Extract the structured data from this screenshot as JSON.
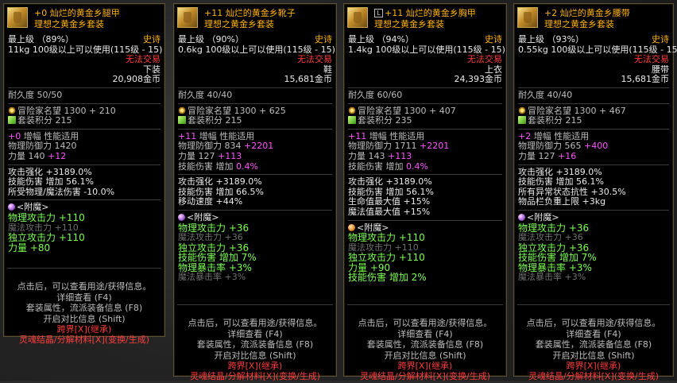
{
  "colors": {
    "legendary": "#ffb400",
    "untradeable": "#ff3c3c",
    "option_green": "#7dff52",
    "bonus_magenta": "#ff55ff",
    "crossover_red": "#ff3c3c"
  },
  "items": [
    {
      "icon": "leg-armor-icon",
      "title": "+0 灿烂的黄金乡腿甲",
      "set_name": "理想之黄金乡套装",
      "grade": "最上级 （89%）",
      "rarity": "史诗",
      "weight_use": "11kg   100级以上可以使用(115级 - 15)",
      "trade": "无法交易",
      "slot": "下装",
      "price": "20,908金币",
      "durability": "耐久度 50/50",
      "fame": "冒险家名望 1300 + 210",
      "set_points": "套装积分 215",
      "amp_line": "+0  增幅 性能适用",
      "amp_prefix": "+0",
      "amp_text": "增幅 性能适用",
      "def_line": "物理防御力 1420",
      "def_bonus": "",
      "str_line": "力量 140",
      "str_bonus": "+12",
      "stats": [
        {
          "text": "攻击强化 +3189.0%",
          "hl": ""
        },
        {
          "text": "技能伤害  增加 56.1%",
          "hl": ""
        },
        {
          "text": "所受物理/魔法伤害 -10.0%",
          "hl": ""
        }
      ],
      "enchant_label": "<附魔>",
      "enchant": [
        {
          "text": "物理攻击力 +110",
          "cls": "white"
        },
        {
          "text": "魔法攻击力 +110",
          "cls": "dim"
        },
        {
          "text": "独立攻击力 +110",
          "cls": "white"
        },
        {
          "text": "力量 +80",
          "cls": "white"
        }
      ],
      "footer": [
        "点击后，可以查看用途/获得信息。",
        "详细查看 (F4)",
        "套装属性，流派装备信息 (F8)",
        "开启对比信息 (Shift)",
        "跨界[X](继承)",
        "灵魂结晶/分解材料[X](变换/生成)"
      ]
    },
    {
      "icon": "boots-icon",
      "title": "+11 灿烂的黄金乡靴子",
      "set_name": "理想之黄金乡套装",
      "grade": "最上级 （90%）",
      "rarity": "史诗",
      "weight_use": "0.6kg   100级以上可以使用(115级 - 15)",
      "trade": "无法交易",
      "slot": "鞋",
      "price": "15,681金币",
      "durability": "耐久度 40/40",
      "fame": "冒险家名望 1300 + 625",
      "set_points": "套装积分 215",
      "amp_prefix": "+11",
      "amp_text": "增幅 性能适用",
      "def_line": "物理防御力 834",
      "def_bonus": "+2201",
      "str_line": "力量 127",
      "str_bonus": "+113",
      "skill_line": "技能伤害  增加",
      "skill_bonus": "0.4%",
      "stats": [
        {
          "text": "攻击强化 +3189.0%"
        },
        {
          "text": "技能伤害  增加 66.5%"
        },
        {
          "text": "移动速度 +44%"
        }
      ],
      "enchant_label": "<附魔>",
      "enchant": [
        {
          "text": "物理攻击力 +36",
          "cls": "white"
        },
        {
          "text": "魔法攻击力 +36",
          "cls": "dim"
        },
        {
          "text": "独立攻击力 +36",
          "cls": "white"
        },
        {
          "text": "技能伤害  增加 7%",
          "cls": "white"
        },
        {
          "text": "物理暴击率 +3%",
          "cls": "white"
        },
        {
          "text": "魔法暴击率 +3%",
          "cls": "dim"
        }
      ],
      "footer": [
        "点击后，可以查看用途/获得信息。",
        "详细查看 (F4)",
        "套装属性，流派装备信息 (F8)",
        "开启对比信息 (Shift)",
        "跨界[X](继承)",
        "灵魂结晶/分解材料[X](变换/生成)"
      ]
    },
    {
      "icon": "chest-armor-icon",
      "lock": "🄻",
      "title": "+11 灿烂的黄金乡胸甲",
      "set_name": "理想之黄金乡套装",
      "grade": "最上级 （94%）",
      "rarity": "史诗",
      "weight_use": "1.4kg   100级以上可以使用(115级 - 15)",
      "trade": "无法交易",
      "slot": "上衣",
      "price": "24,393金币",
      "durability": "耐久度 60/60",
      "fame": "冒险家名望 1300 + 407",
      "set_points": "套装积分 235",
      "amp_prefix": "+11",
      "amp_text": "增幅 性能适用",
      "def_line": "物理防御力 1711",
      "def_bonus": "+2201",
      "str_line": "力量 143",
      "str_bonus": "+113",
      "skill_line": "技能伤害  增加",
      "skill_bonus": "0.4%",
      "stats": [
        {
          "text": "攻击强化 +3189.0%"
        },
        {
          "text": "技能伤害  增加 56.1%"
        },
        {
          "text": "生命值最大值 +15%"
        },
        {
          "text": "魔法值最大值 +15%"
        }
      ],
      "enchant_label": "<附魔>",
      "enchant": [
        {
          "text": "物理攻击力 +110",
          "cls": "white"
        },
        {
          "text": "魔法攻击力 +110",
          "cls": "dim"
        },
        {
          "text": "独立攻击力 +110",
          "cls": "white"
        },
        {
          "text": "力量 +90",
          "cls": "white"
        },
        {
          "text": "技能伤害  增加 2%",
          "cls": "white"
        }
      ],
      "footer": [
        "点击后，可以查看用途/获得信息。",
        "详细查看 (F4)",
        "套装属性，流派装备信息 (F8)",
        "开启对比信息 (Shift)",
        "跨界[X](继承)",
        "灵魂结晶/分解材料[X](变换/生成)"
      ]
    },
    {
      "icon": "belt-icon",
      "title": "+2 灿烂的黄金乡腰带",
      "set_name": "理想之黄金乡套装",
      "grade": "最上级 （93%）",
      "rarity": "史诗",
      "weight_use": "0.55kg   100级以上可以使用(115级 - 15)",
      "trade": "无法交易",
      "slot": "腰带",
      "price": "15,681金币",
      "durability": "耐久度 40/40",
      "fame": "冒险家名望 1300 + 467",
      "set_points": "套装积分 215",
      "amp_prefix": "+2",
      "amp_text": "增幅 性能适用",
      "def_line": "物理防御力 565",
      "def_bonus": "+400",
      "str_line": "力量 127",
      "str_bonus": "+16",
      "stats": [
        {
          "text": "攻击强化 +3189.0%"
        },
        {
          "text": "技能伤害  增加 56.1%"
        },
        {
          "text": "所有异常状态抗性 +30.5%"
        },
        {
          "text": "物品栏负重上限 +3kg"
        }
      ],
      "enchant_label": "<附魔>",
      "enchant": [
        {
          "text": "物理攻击力 +36",
          "cls": "white"
        },
        {
          "text": "魔法攻击力 +36",
          "cls": "dim"
        },
        {
          "text": "独立攻击力 +36",
          "cls": "white"
        },
        {
          "text": "技能伤害  增加 7%",
          "cls": "white"
        },
        {
          "text": "物理暴击率 +3%",
          "cls": "white"
        },
        {
          "text": "魔法暴击率 +3%",
          "cls": "dim"
        }
      ],
      "footer": [
        "点击后，可以查看用途/获得信息。",
        "详细查看 (F4)",
        "套装属性，流派装备信息 (F8)",
        "开启对比信息 (Shift)",
        "跨界[X](继承)",
        "灵魂结晶/分解材料[X](变换/生成)"
      ]
    }
  ]
}
